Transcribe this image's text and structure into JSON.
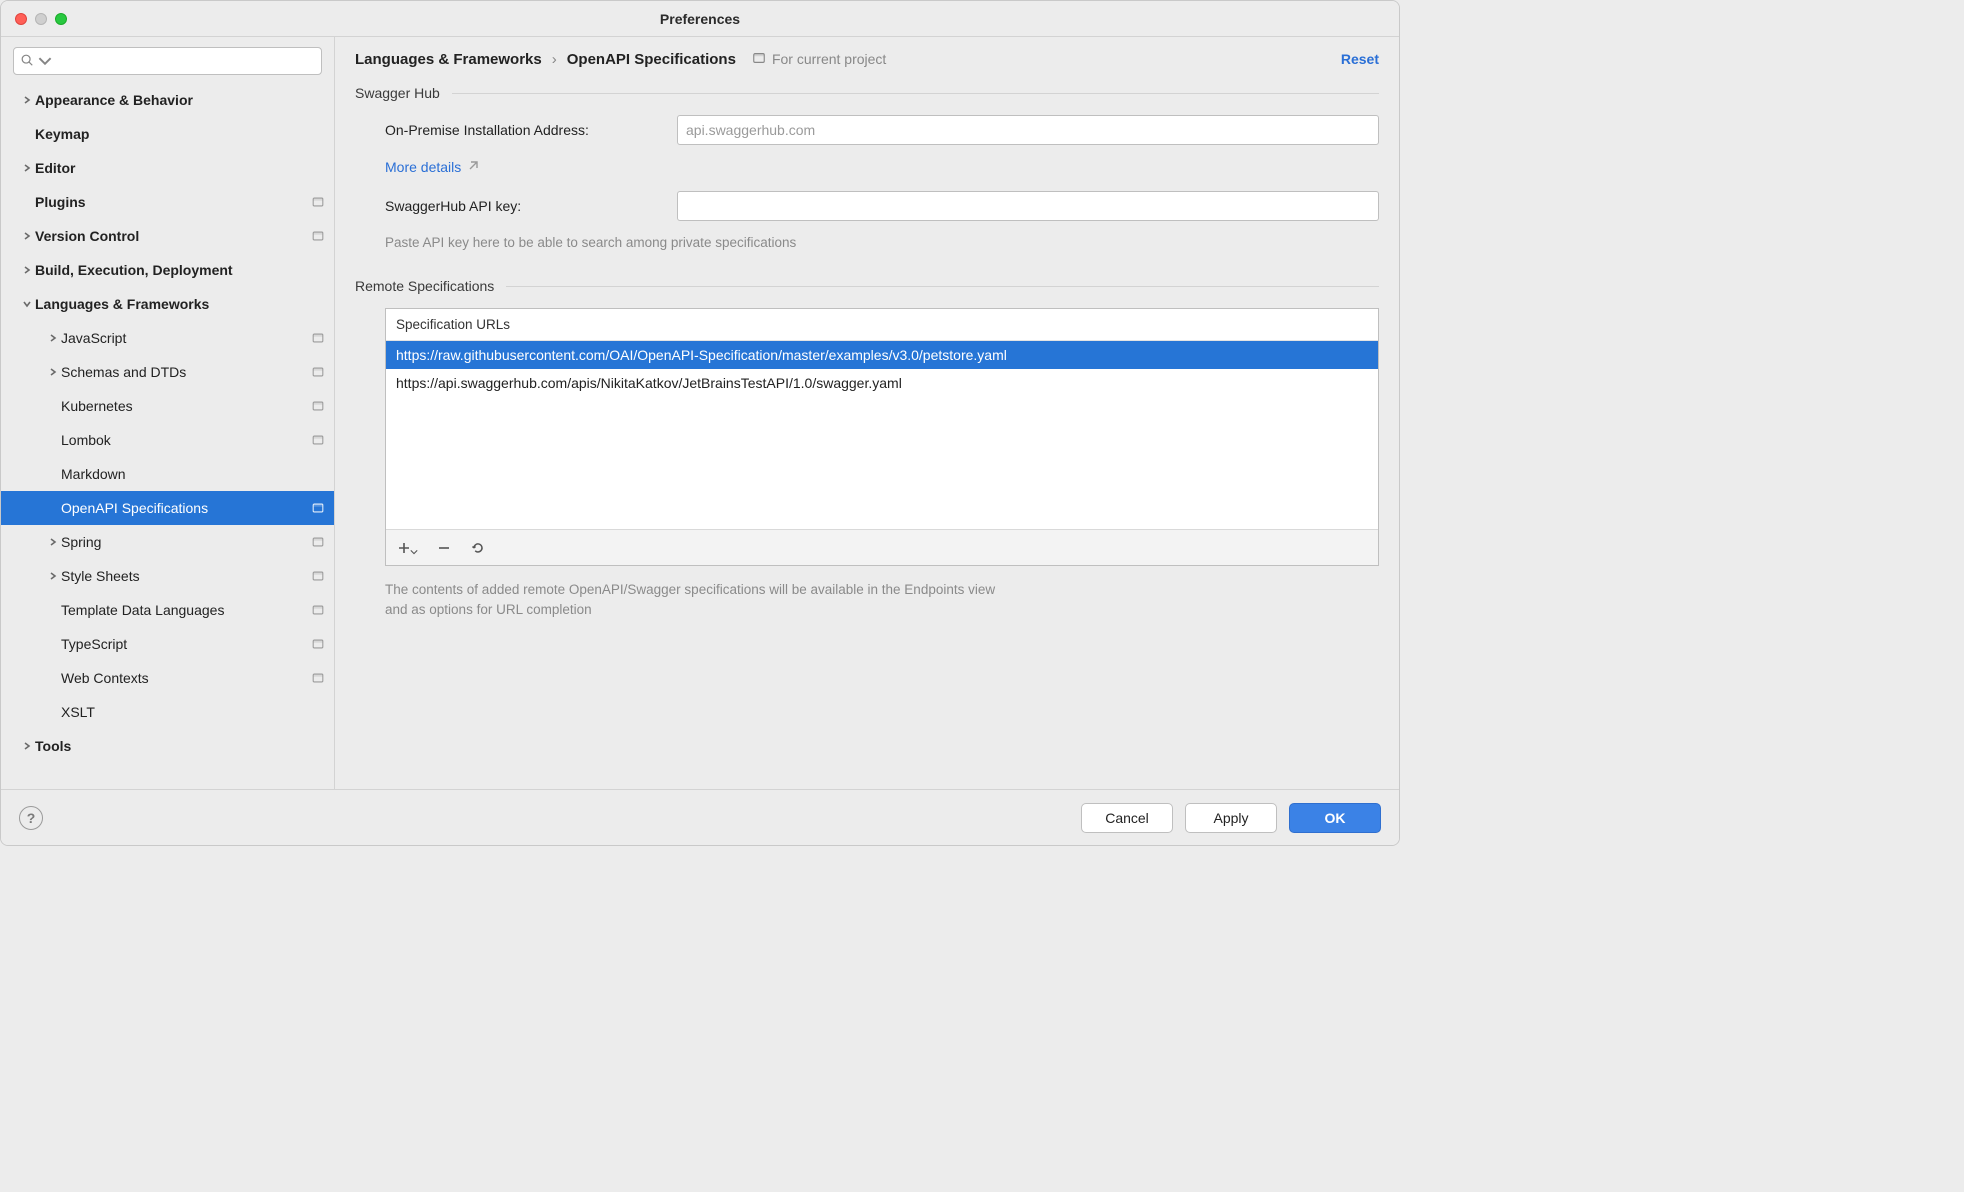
{
  "window": {
    "title": "Preferences"
  },
  "sidebar": {
    "search_placeholder": "",
    "items": [
      {
        "label": "Appearance & Behavior",
        "depth": 0,
        "expandable": true,
        "expanded": false,
        "project": false
      },
      {
        "label": "Keymap",
        "depth": 0,
        "expandable": false,
        "project": false
      },
      {
        "label": "Editor",
        "depth": 0,
        "expandable": true,
        "expanded": false,
        "project": false
      },
      {
        "label": "Plugins",
        "depth": 0,
        "expandable": false,
        "project": true
      },
      {
        "label": "Version Control",
        "depth": 0,
        "expandable": true,
        "expanded": false,
        "project": true
      },
      {
        "label": "Build, Execution, Deployment",
        "depth": 0,
        "expandable": true,
        "expanded": false,
        "project": false
      },
      {
        "label": "Languages & Frameworks",
        "depth": 0,
        "expandable": true,
        "expanded": true,
        "project": false
      },
      {
        "label": "JavaScript",
        "depth": 1,
        "expandable": true,
        "expanded": false,
        "project": true
      },
      {
        "label": "Schemas and DTDs",
        "depth": 1,
        "expandable": true,
        "expanded": false,
        "project": true
      },
      {
        "label": "Kubernetes",
        "depth": 1,
        "expandable": false,
        "project": true
      },
      {
        "label": "Lombok",
        "depth": 1,
        "expandable": false,
        "project": true
      },
      {
        "label": "Markdown",
        "depth": 1,
        "expandable": false,
        "project": false
      },
      {
        "label": "OpenAPI Specifications",
        "depth": 1,
        "expandable": false,
        "project": true,
        "selected": true
      },
      {
        "label": "Spring",
        "depth": 1,
        "expandable": true,
        "expanded": false,
        "project": true
      },
      {
        "label": "Style Sheets",
        "depth": 1,
        "expandable": true,
        "expanded": false,
        "project": true
      },
      {
        "label": "Template Data Languages",
        "depth": 1,
        "expandable": false,
        "project": true
      },
      {
        "label": "TypeScript",
        "depth": 1,
        "expandable": false,
        "project": true
      },
      {
        "label": "Web Contexts",
        "depth": 1,
        "expandable": false,
        "project": true
      },
      {
        "label": "XSLT",
        "depth": 1,
        "expandable": false,
        "project": false
      },
      {
        "label": "Tools",
        "depth": 0,
        "expandable": true,
        "expanded": false,
        "project": false
      }
    ]
  },
  "breadcrumb": {
    "root": "Languages & Frameworks",
    "leaf": "OpenAPI Specifications"
  },
  "scope": {
    "label": "For current project"
  },
  "reset": {
    "label": "Reset"
  },
  "swaggerhub": {
    "section_title": "Swagger Hub",
    "address_label": "On-Premise Installation Address:",
    "address_placeholder": "api.swaggerhub.com",
    "address_value": "",
    "more_details_label": "More details",
    "api_key_label": "SwaggerHub API key:",
    "api_key_value": "",
    "api_key_hint": "Paste API key here to be able to search among private specifications"
  },
  "remote": {
    "section_title": "Remote Specifications",
    "column_header": "Specification URLs",
    "urls": [
      {
        "url": "https://raw.githubusercontent.com/OAI/OpenAPI-Specification/master/examples/v3.0/petstore.yaml",
        "selected": true
      },
      {
        "url": "https://api.swaggerhub.com/apis/NikitaKatkov/JetBrainsTestAPI/1.0/swagger.yaml",
        "selected": false
      }
    ],
    "hint": "The contents of added remote OpenAPI/Swagger specifications will be available in the Endpoints view and as options for URL completion"
  },
  "footer": {
    "cancel": "Cancel",
    "apply": "Apply",
    "ok": "OK"
  }
}
